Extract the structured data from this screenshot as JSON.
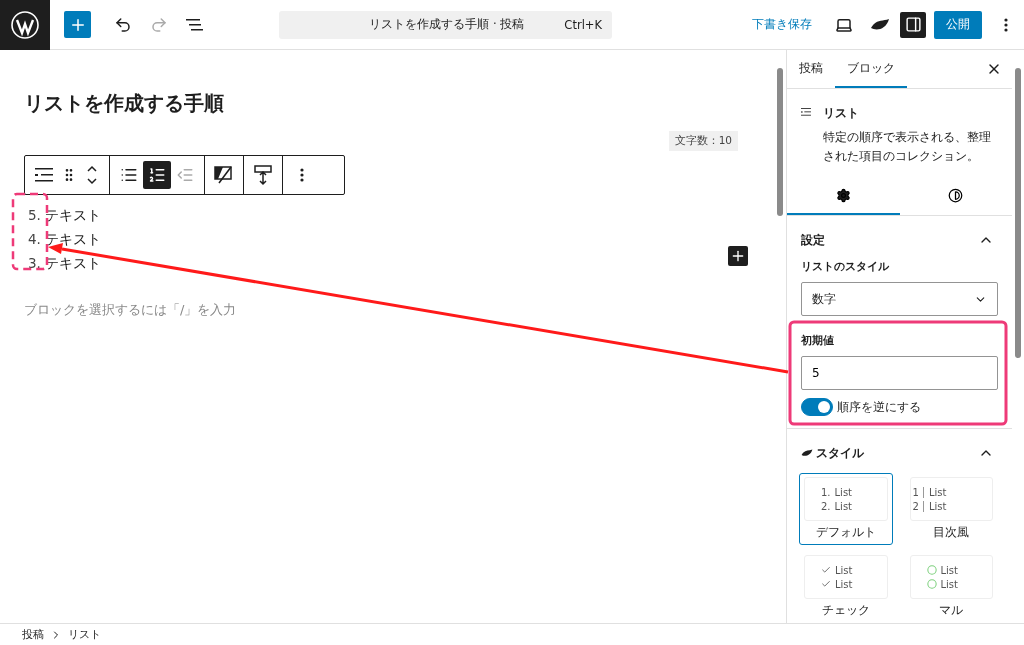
{
  "header": {
    "command_bar": {
      "title": "リストを作成する手順 · 投稿",
      "shortcut": "Ctrl+K"
    },
    "save_draft": "下書き保存",
    "settings_panel_open": true,
    "publish": "公開"
  },
  "editor": {
    "title": "リストを作成する手順",
    "word_count": "文字数：10",
    "toolbar": {
      "list_buttons": [
        {
          "kind": "unordered",
          "selected": false
        },
        {
          "kind": "ordered",
          "selected": true
        }
      ]
    },
    "items": [
      {
        "number": "5.",
        "text": "テキスト"
      },
      {
        "number": "4.",
        "text": "テキスト"
      },
      {
        "number": "3.",
        "text": "テキスト"
      }
    ],
    "placeholder": "ブロックを選択するには「/」を入力"
  },
  "sidebar": {
    "tabs": [
      {
        "label": "投稿",
        "selected": false
      },
      {
        "label": "ブロック",
        "selected": true
      }
    ],
    "block": {
      "name": "リスト",
      "description": "特定の順序で表示される、整理された項目のコレクション。"
    },
    "inspector_tabs": [
      {
        "kind": "settings",
        "selected": true
      },
      {
        "kind": "styles",
        "selected": false
      }
    ],
    "settings": {
      "title": "設定",
      "expanded": true,
      "list_style_label": "リストのスタイル",
      "list_style_value": "数字",
      "start_label": "初期値",
      "start_value": "5",
      "reversed": {
        "label": "順序を逆にする",
        "on": true
      }
    },
    "styles": {
      "title": "スタイル",
      "expanded": true,
      "options": [
        {
          "kind": "numbered",
          "label": "デフォルト",
          "selected": true,
          "lines": [
            {
              "marker": "1.",
              "text": "List"
            },
            {
              "marker": "2.",
              "text": "List"
            }
          ]
        },
        {
          "kind": "toc",
          "label": "目次風",
          "selected": false,
          "lines": [
            {
              "marker": "1",
              "text": "List"
            },
            {
              "marker": "2",
              "text": "List"
            }
          ]
        },
        {
          "kind": "check",
          "label": "チェック",
          "selected": false,
          "lines": [
            {
              "text": "List"
            },
            {
              "text": "List"
            }
          ]
        },
        {
          "kind": "circle",
          "label": "マル",
          "selected": false,
          "lines": [
            {
              "text": "List"
            },
            {
              "text": "List"
            }
          ]
        }
      ]
    }
  },
  "breadcrumb": [
    "投稿",
    "リスト"
  ]
}
